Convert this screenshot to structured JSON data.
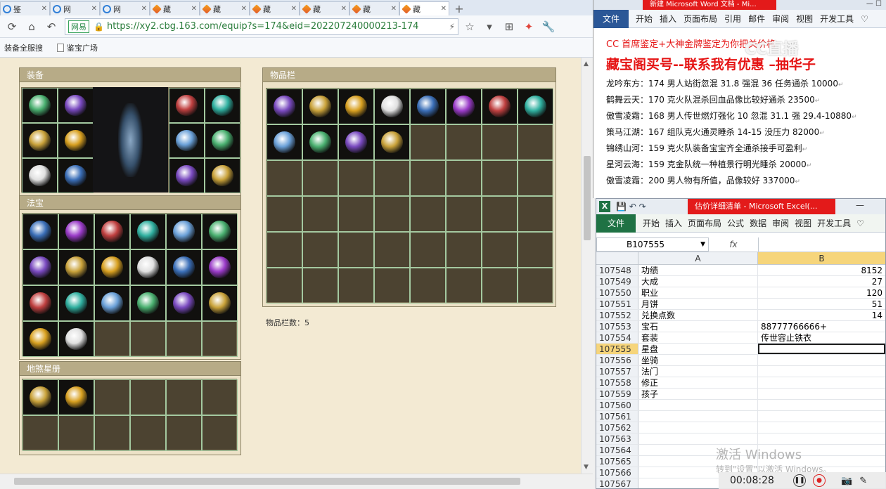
{
  "browser": {
    "tabs": [
      {
        "label": "鉴",
        "icon": "ie",
        "active": false
      },
      {
        "label": "网",
        "icon": "chrome",
        "active": false
      },
      {
        "label": "网",
        "icon": "chrome",
        "active": false
      },
      {
        "label": "藏",
        "icon": "cbg",
        "active": false
      },
      {
        "label": "藏",
        "icon": "cbg",
        "active": false
      },
      {
        "label": "藏",
        "icon": "cbg",
        "active": false
      },
      {
        "label": "藏",
        "icon": "cbg",
        "active": false
      },
      {
        "label": "藏",
        "icon": "cbg",
        "active": false
      },
      {
        "label": "藏",
        "icon": "cbg",
        "active": true
      }
    ],
    "new_tab": "+",
    "url_site_label": "网易",
    "url": "https://xy2.cbg.163.com/equip?s=174&eid=202207240000213-174",
    "bookmarks": [
      "装备全服搜",
      "鉴宝广场"
    ]
  },
  "page": {
    "equip_title": "装备",
    "fabao_title": "法宝",
    "xingce_title": "地煞星册",
    "inventory_title": "物品栏",
    "inventory_count": "物品栏数：5"
  },
  "word": {
    "title": "新建 Microsoft Word 文档 - Mi...",
    "ribbon_file": "文件",
    "ribbon_tabs": [
      "开始",
      "插入",
      "页面布局",
      "引用",
      "邮件",
      "审阅",
      "视图",
      "开发工具"
    ],
    "line1": "CC 首席鉴定+大神金牌鉴定为你把关价格",
    "line2": "藏宝阁买号--联系我有优惠 –抽华子",
    "lines": [
      "龙吟东方：174 男人站街忽混 31.8 强混 36 任务通杀 10000",
      "鹤舞云天：170 克火队混杀回血品像比较好通杀 23500",
      "傲雪凌霜：168 男人传世燃灯强化 10 忽混 31.1 强 29.4-10880",
      "策马江湖：167 组队克火通灵睡杀 14-15 没压力 82000",
      "锦绣山河：159 克火队装备宝宝齐全通杀接手可盈利",
      "星河云海：159 克金队统一种植景行明光睡杀 20000",
      "傲雪凌霜：200 男人物有所值，品像较好 337000"
    ],
    "watermark": "CC直播"
  },
  "excel": {
    "title": "估价详细清单 - Microsoft Excel(...",
    "ribbon_file": "文件",
    "ribbon_tabs": [
      "开始",
      "插入",
      "页面布局",
      "公式",
      "数据",
      "审阅",
      "视图",
      "开发工具"
    ],
    "name_box": "B107555",
    "fx": "fx",
    "col_a": "A",
    "col_b": "B",
    "rows": [
      {
        "n": "107548",
        "a": "功绩",
        "b": "8152",
        "num": true
      },
      {
        "n": "107549",
        "a": "大成",
        "b": "27",
        "num": true
      },
      {
        "n": "107550",
        "a": "职业",
        "b": "120",
        "num": true
      },
      {
        "n": "107551",
        "a": "月饼",
        "b": "51",
        "num": true
      },
      {
        "n": "107552",
        "a": "兑换点数",
        "b": "14",
        "num": true
      },
      {
        "n": "107553",
        "a": "宝石",
        "b": "88777766666+",
        "num": false
      },
      {
        "n": "107554",
        "a": "套装",
        "b": "传世容止铁衣",
        "num": false
      },
      {
        "n": "107555",
        "a": "星盘",
        "b": "",
        "num": false,
        "selected": true
      },
      {
        "n": "107556",
        "a": "坐骑",
        "b": "",
        "num": false
      },
      {
        "n": "107557",
        "a": "法门",
        "b": "",
        "num": false
      },
      {
        "n": "107558",
        "a": "修正",
        "b": "",
        "num": false
      },
      {
        "n": "107559",
        "a": "孩子",
        "b": "",
        "num": false
      },
      {
        "n": "107560",
        "a": "",
        "b": "",
        "num": false
      },
      {
        "n": "107561",
        "a": "",
        "b": "",
        "num": false
      },
      {
        "n": "107562",
        "a": "",
        "b": "",
        "num": false
      },
      {
        "n": "107563",
        "a": "",
        "b": "",
        "num": false
      },
      {
        "n": "107564",
        "a": "",
        "b": "",
        "num": false
      },
      {
        "n": "107565",
        "a": "",
        "b": "",
        "num": false
      },
      {
        "n": "107566",
        "a": "",
        "b": "",
        "num": false
      },
      {
        "n": "107567",
        "a": "",
        "b": "",
        "num": false
      }
    ],
    "win_mark1": "激活 Windows",
    "win_mark2": "转到\"设置\"以激活 Windows。"
  },
  "recorder": {
    "time": "00:08:28"
  },
  "colors": {
    "item_palette": [
      "#3b6fb8",
      "#c9a23a",
      "#6aa0d8",
      "#9a3bc8",
      "#d8a020",
      "#4ab070",
      "#c04040",
      "#e0e0e0",
      "#7a4ac0",
      "#30b0a0"
    ]
  }
}
